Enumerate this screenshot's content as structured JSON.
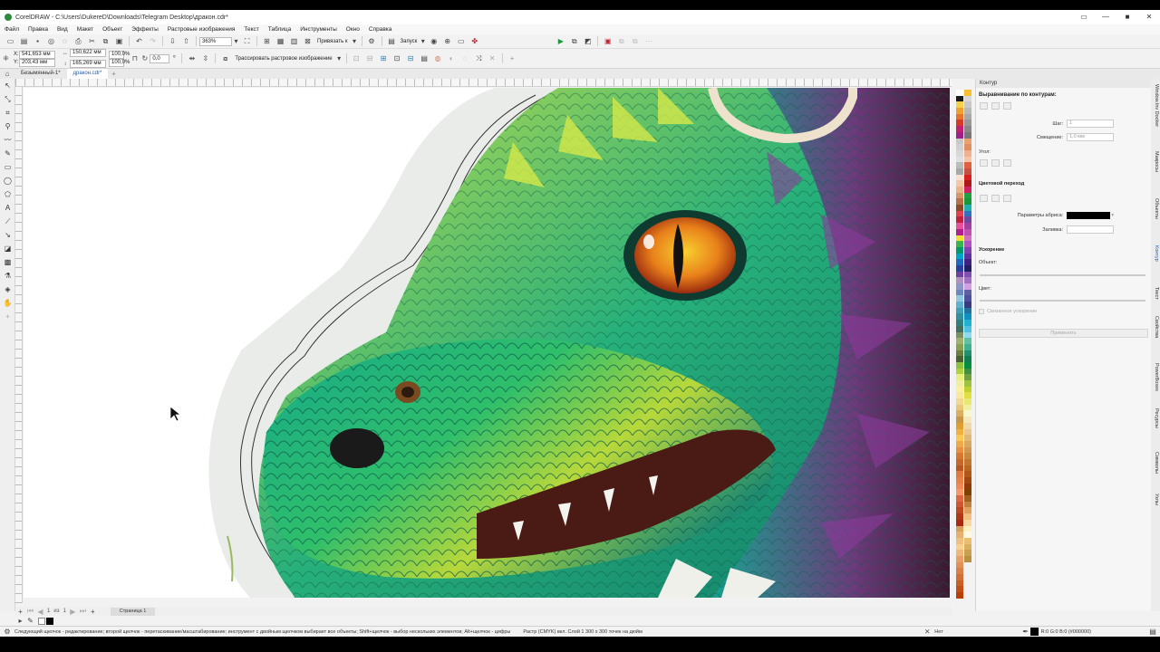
{
  "app": {
    "title": "CorelDRAW - C:\\Users\\DukereD\\Downloads\\Telegram Desktop\\дракон.cdr*",
    "window_buttons": [
      "▭",
      "—",
      "■",
      "✕"
    ]
  },
  "menu": [
    "Файл",
    "Правка",
    "Вид",
    "Макет",
    "Объект",
    "Эффекты",
    "Растровые изображения",
    "Текст",
    "Таблица",
    "Инструменты",
    "Окно",
    "Справка"
  ],
  "toolbar": {
    "zoom": "363%",
    "snap_label": "Привязать к",
    "launch_label": "Запуск"
  },
  "property_bar": {
    "x": "541,653 мм",
    "y": "203,43 мм",
    "width": "150,622 мм",
    "height": "165,269 мм",
    "scale_w": "100,0",
    "scale_h": "100,0",
    "scale_unit": "%",
    "angle": "0,0",
    "trace_label": "Трассировать растровое изображение"
  },
  "tabs": [
    {
      "label": "Безымянный-1*",
      "active": false
    },
    {
      "label": "дракон.cdr*",
      "active": true
    }
  ],
  "docker": {
    "title": "Контур",
    "align_title": "Выравнивание по контурам:",
    "step_label": "Шаг:",
    "step_value": "1",
    "offset_label": "Смещение:",
    "offset_value": "1,0 мм",
    "corner_label": "Угол:",
    "blend_title": "Цветовой переход",
    "outline_params_label": "Параметры абриса:",
    "fill_label": "Заливка:",
    "accel_title": "Ускорение",
    "object_label": "Объект:",
    "color_label": "Цвет:",
    "linked_label": "Связанное ускорение",
    "apply_label": "Применить"
  },
  "side_tabs": [
    "Window.Inv Docker",
    "Макросы",
    "Объекты",
    "Контур",
    "Текст",
    "Свойства",
    "PowerBoxes",
    "Ресурсы",
    "Символы",
    "Узлы"
  ],
  "page_nav": {
    "current": "1",
    "of": "из",
    "total": "1",
    "page_tab": "Страница 1"
  },
  "status": {
    "hint": "Следующий щелчок - редактирование; второй щелчок - перетаскивание/масштабирование; инструмент с двойным щелчком выбирает все объекты; Shift+щелчок - выбор нескольких элементов; Alt+щелчок - цифры",
    "object_info": "Растр (CMYK) вкл. Слой 1  300 x 300 точек на дюйм",
    "fill_none": "Нет",
    "color_readout": "R:0 G:0 B:0 (#000000)"
  },
  "palette_left": [
    "#ffffff",
    "#1a1a1a",
    "#f7d04a",
    "#f0a030",
    "#e8732a",
    "#d53a2a",
    "#c22070",
    "#a0208a",
    "#c8c8c8",
    "#d0d0d0",
    "#d8d8d8",
    "#e0e0e0",
    "#bcbcbc",
    "#a8a8a8",
    "#ffe0d0",
    "#f6c8a8",
    "#e9b48a",
    "#d8956a",
    "#b87048",
    "#8c4a28",
    "#e04050",
    "#c02040",
    "#e94f9a",
    "#b02090",
    "#f2e030",
    "#39b54a",
    "#009a6a",
    "#00a3c8",
    "#1e6ac0",
    "#2840a0",
    "#7040a0",
    "#b090c0",
    "#8c96c8",
    "#6c86c0",
    "#92c8e0",
    "#60b0d0",
    "#40a0b8",
    "#3090a0",
    "#308080",
    "#407060",
    "#7a9060",
    "#a0b070",
    "#8aa050",
    "#6a8040",
    "#4a6030",
    "#90c040",
    "#b0d040",
    "#e8f080",
    "#f0f0a0",
    "#fff0a0",
    "#f8e8a0",
    "#f0d890",
    "#e8c878",
    "#d8b060",
    "#c89848",
    "#e0a030",
    "#f0b040",
    "#f8c850",
    "#f0a848",
    "#e89040",
    "#d87830",
    "#c86828",
    "#b85820",
    "#e07840",
    "#e88048",
    "#f08858",
    "#f89868",
    "#e06840",
    "#d05830",
    "#c04820",
    "#b03818",
    "#a82810",
    "#d8a060",
    "#e8b070",
    "#f0c080",
    "#f8d090",
    "#f0b878",
    "#e8a068",
    "#e09058",
    "#d88048",
    "#d07038",
    "#c86028",
    "#c05018",
    "#b84008"
  ],
  "palette_right": [
    "#f6c030",
    "#d8d8d8",
    "#c8c8c8",
    "#b8b8b8",
    "#a8a8a8",
    "#989898",
    "#888888",
    "#787878",
    "#e8a070",
    "#e09060",
    "#f0b090",
    "#f5c5a5",
    "#e06040",
    "#c85040",
    "#d82020",
    "#b01818",
    "#d02060",
    "#20a040",
    "#189838",
    "#20b0b0",
    "#3070c0",
    "#7048a0",
    "#a040a0",
    "#c050b0",
    "#d070c0",
    "#b050c0",
    "#8040b0",
    "#6030a0",
    "#402080",
    "#202060",
    "#8050b0",
    "#a070c0",
    "#d0a0e0",
    "#6060a0",
    "#5050a0",
    "#3a3a80",
    "#2070a0",
    "#1090c0",
    "#20b0d0",
    "#50c0e0",
    "#90d8f0",
    "#60c0a0",
    "#40b090",
    "#209070",
    "#108050",
    "#009040",
    "#409040",
    "#70a040",
    "#a0c040",
    "#c0d030",
    "#e0e040",
    "#e8e870",
    "#f0f0a0",
    "#f8f8d0",
    "#f8e8c0",
    "#f0d8a8",
    "#e8c890",
    "#e0b878",
    "#d8a860",
    "#d09850",
    "#c88840",
    "#c07830",
    "#b86820",
    "#b05818",
    "#a04810",
    "#903808",
    "#804000",
    "#a06020",
    "#c08040",
    "#e0a060",
    "#f0c080",
    "#f8d8a0",
    "#fff0c0",
    "#fff8e0",
    "#e8c070",
    "#d8b060",
    "#c8a050",
    "#b89040"
  ]
}
